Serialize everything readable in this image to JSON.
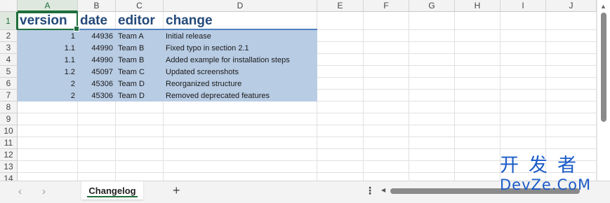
{
  "columns": [
    "A",
    "B",
    "C",
    "D",
    "E",
    "F",
    "G",
    "H",
    "I",
    "J"
  ],
  "rows": [
    "1",
    "2",
    "3",
    "4",
    "5",
    "6",
    "7",
    "8",
    "9",
    "10",
    "11",
    "12",
    "13",
    "14"
  ],
  "table": {
    "headers": [
      "version",
      "date",
      "editor",
      "change"
    ],
    "data": [
      [
        "1",
        "44936",
        "Team A",
        "Initial release"
      ],
      [
        "1.1",
        "44990",
        "Team B",
        "Fixed typo in section 2.1"
      ],
      [
        "1.1",
        "44990",
        "Team B",
        "Added example for installation steps"
      ],
      [
        "1.2",
        "45097",
        "Team C",
        "Updated screenshots"
      ],
      [
        "2",
        "45306",
        "Team D",
        "Reorganized structure"
      ],
      [
        "2",
        "45306",
        "Team D",
        "Removed deprecated features"
      ]
    ]
  },
  "tabs": {
    "active_sheet": "Changelog",
    "prev_icon": "chevron-left-icon",
    "next_icon": "chevron-right-icon",
    "add_icon": "plus-icon",
    "more_icon": "more-vertical-icon"
  },
  "watermark": {
    "cn": "开发者",
    "en": "DevZe.CoM"
  },
  "colors": {
    "accent": "#1f6e3b",
    "band": "#b8cce4",
    "header_text": "#24497a",
    "header_rule": "#4f81bd"
  }
}
